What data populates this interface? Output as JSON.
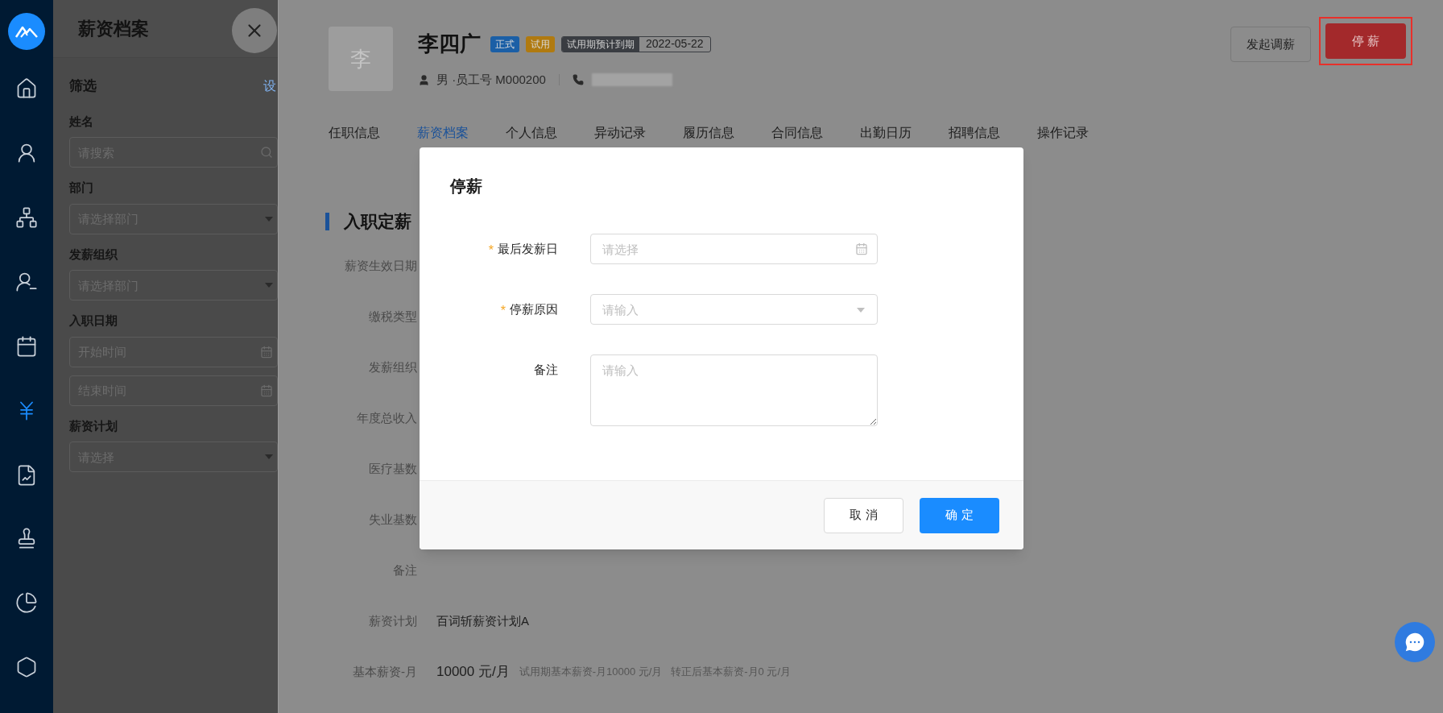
{
  "nav": [
    {
      "selected": false
    },
    {
      "selected": false
    },
    {
      "selected": false
    },
    {
      "selected": false
    },
    {
      "selected": false
    },
    {
      "selected": true
    },
    {
      "selected": false
    },
    {
      "selected": false
    },
    {
      "selected": false
    },
    {
      "selected": false
    }
  ],
  "filter_panel": {
    "title": "薪资档案",
    "section": "筛选",
    "section_link": "设",
    "fields": [
      {
        "label": "姓名",
        "kind": "search",
        "placeholder": "请搜索"
      },
      {
        "label": "部门",
        "kind": "select",
        "placeholder": "请选择部门"
      },
      {
        "label": "发薪组织",
        "kind": "select",
        "placeholder": "请选择部门"
      },
      {
        "label": "入职日期",
        "kind": "date",
        "placeholder": "开始时间"
      },
      {
        "kind": "date",
        "placeholder": "结束时间"
      },
      {
        "label": "薪资计划",
        "kind": "select",
        "placeholder": "请选择"
      }
    ]
  },
  "employee": {
    "avatar": "李",
    "name": "李四广",
    "tags": [
      {
        "text": "正式",
        "color": "#1b5fa6"
      },
      {
        "text": "试用",
        "color": "#b07a10"
      }
    ],
    "probation_label": "试用期预计到期",
    "probation_date": "2022-05-22",
    "info": "男 ·员工号 M000200"
  },
  "actions": [
    {
      "label": "发起调薪",
      "kind": "default",
      "highlighted": false
    },
    {
      "label": "停 薪",
      "kind": "danger",
      "highlighted": true
    }
  ],
  "tabs": [
    {
      "label": "任职信息",
      "selected": false
    },
    {
      "label": "薪资档案",
      "selected": true
    },
    {
      "label": "个人信息",
      "selected": false
    },
    {
      "label": "异动记录",
      "selected": false
    },
    {
      "label": "履历信息",
      "selected": false
    },
    {
      "label": "合同信息",
      "selected": false
    },
    {
      "label": "出勤日历",
      "selected": false
    },
    {
      "label": "招聘信息",
      "selected": false
    },
    {
      "label": "操作记录",
      "selected": false
    }
  ],
  "section": {
    "title": "入职定薪",
    "rows": [
      {
        "label": "薪资生效日期"
      },
      {
        "label": "缴税类型"
      },
      {
        "label": "发薪组织"
      },
      {
        "label": "年度总收入"
      },
      {
        "label": "医疗基数"
      },
      {
        "label": "失业基数"
      },
      {
        "label": "备注"
      },
      {
        "label": "薪资计划",
        "value": "百词斩薪资计划A"
      },
      {
        "label": "基本薪资-月",
        "value": "10000 元/月",
        "note": "试用期基本薪资-月10000 元/月   转正后基本薪资-月0 元/月"
      }
    ]
  },
  "dialog": {
    "title": "停薪",
    "required_mark": "*",
    "fields": [
      {
        "label": "最后发薪日",
        "required": true,
        "kind": "date",
        "placeholder": "请选择"
      },
      {
        "label": "停薪原因",
        "required": true,
        "kind": "select",
        "placeholder": "请输入"
      },
      {
        "label": "备注",
        "required": false,
        "kind": "textarea",
        "placeholder": "请输入"
      }
    ],
    "buttons": [
      {
        "label": "取 消",
        "kind": "default"
      },
      {
        "label": "确 定",
        "kind": "primary"
      }
    ]
  }
}
